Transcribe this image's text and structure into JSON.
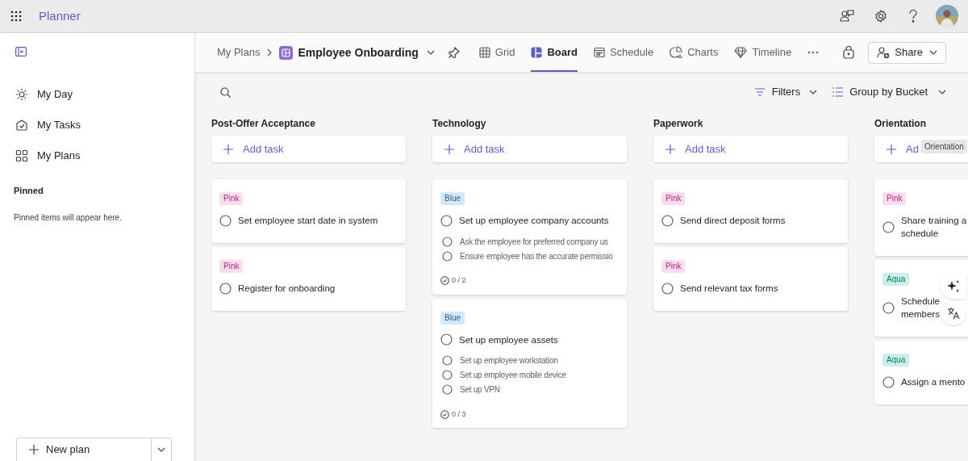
{
  "app": {
    "title": "Planner"
  },
  "sidebar": {
    "items": [
      {
        "label": "My Day"
      },
      {
        "label": "My Tasks"
      },
      {
        "label": "My Plans"
      }
    ],
    "pinned_heading": "Pinned",
    "pinned_empty": "Pinned items will appear here.",
    "new_plan": "New plan"
  },
  "header": {
    "breadcrumb": "My Plans",
    "plan_title": "Employee Onboarding",
    "tabs": [
      {
        "label": "Grid",
        "selected": false
      },
      {
        "label": "Board",
        "selected": true
      },
      {
        "label": "Schedule",
        "selected": false
      },
      {
        "label": "Charts",
        "selected": false
      },
      {
        "label": "Timeline",
        "selected": false
      }
    ],
    "share": "Share"
  },
  "toolbar": {
    "filters": "Filters",
    "group_by": "Group by Bucket"
  },
  "buckets": [
    {
      "name": "Post-Offer Acceptance",
      "add_task": "Add task",
      "tasks": [
        {
          "label": {
            "text": "Pink",
            "color": "#fbdcef"
          },
          "title_lines": [
            "Set employee start date in system"
          ],
          "checked": false
        },
        {
          "label": {
            "text": "Pink",
            "color": "#fbdcef"
          },
          "title_lines": [
            "Register for onboarding"
          ],
          "checked": false
        }
      ]
    },
    {
      "name": "Technology",
      "add_task": "Add task",
      "tasks": [
        {
          "label": {
            "text": "Blue",
            "color": "#d3e8f8"
          },
          "title_lines": [
            "Set up employee company accounts"
          ],
          "checked": false,
          "subtasks": [
            {
              "text": "Ask the employee for preferred company us",
              "checked": false
            },
            {
              "text": "Ensure employee has the accurate permissio",
              "checked": false
            }
          ],
          "progress": "0 / 2"
        },
        {
          "label": {
            "text": "Blue",
            "color": "#d3e8f8"
          },
          "title_lines": [
            "Set up employee assets"
          ],
          "checked": false,
          "subtasks": [
            {
              "text": "Set up employee workstation",
              "checked": false
            },
            {
              "text": "Set up employee mobile device",
              "checked": false
            },
            {
              "text": "Set up VPN",
              "checked": false
            }
          ],
          "progress": "0 / 3"
        }
      ]
    },
    {
      "name": "Paperwork",
      "add_task": "Add task",
      "tasks": [
        {
          "label": {
            "text": "Pink",
            "color": "#fbdcef"
          },
          "title_lines": [
            "Send direct deposit forms"
          ],
          "checked": false
        },
        {
          "label": {
            "text": "Pink",
            "color": "#fbdcef"
          },
          "title_lines": [
            "Send relevant tax forms"
          ],
          "checked": false
        }
      ]
    },
    {
      "name": "Orientation",
      "add_task": "Ad",
      "tasks": [
        {
          "label": {
            "text": "Pink",
            "color": "#fbdcef"
          },
          "title_lines": [
            "Share training a",
            "schedule"
          ],
          "checked": false
        },
        {
          "label": {
            "text": "Aqua",
            "color": "#cbeeea"
          },
          "title_lines": [
            "Schedule",
            "members"
          ],
          "checked": false
        },
        {
          "label": {
            "text": "Aqua",
            "color": "#cbeeea"
          },
          "title_lines": [
            "Assign a mento"
          ],
          "checked": false
        }
      ]
    }
  ],
  "tooltip": "Orientation"
}
